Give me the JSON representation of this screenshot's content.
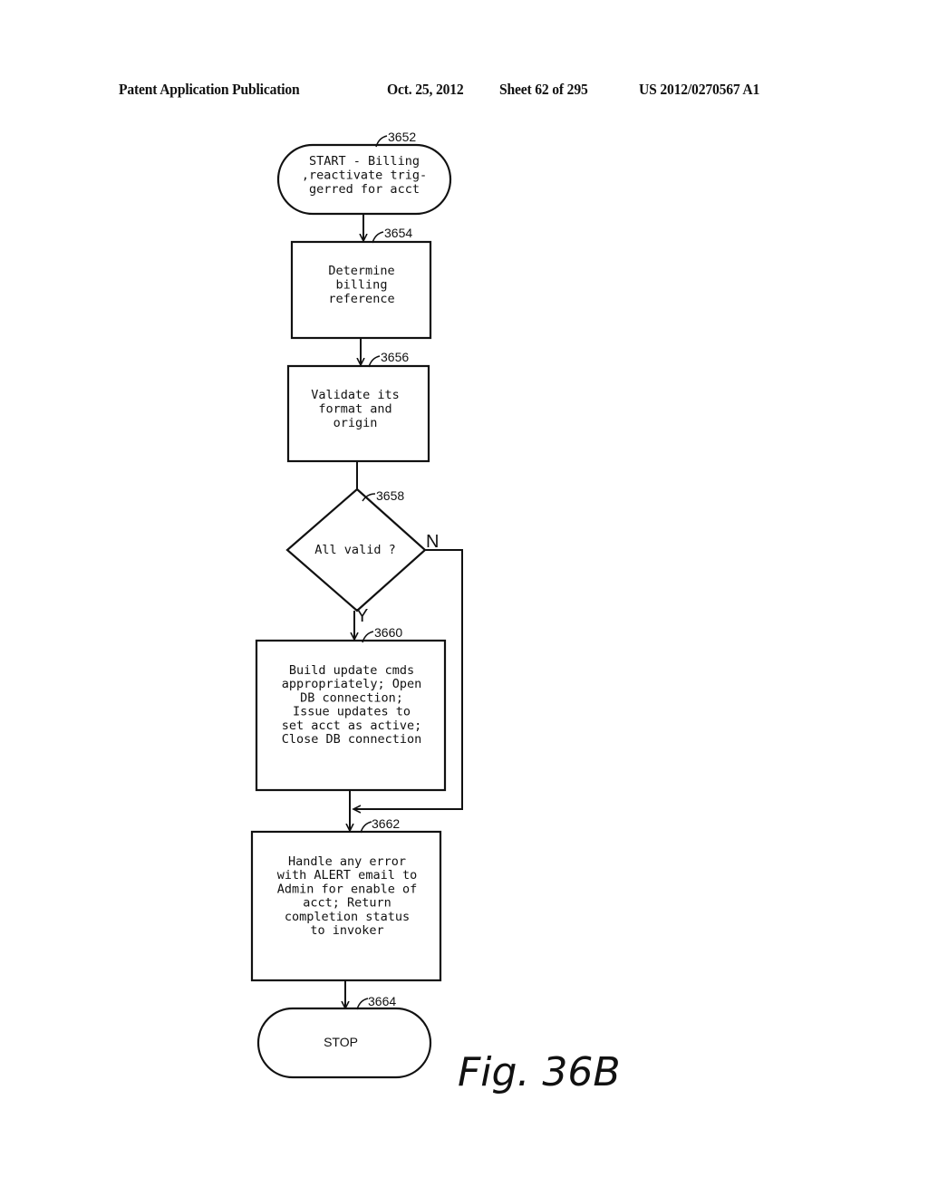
{
  "header": {
    "publication": "Patent Application Publication",
    "date": "Oct. 25, 2012",
    "sheet": "Sheet 62 of 295",
    "number": "US 2012/0270567 A1"
  },
  "flowchart": {
    "nodes": [
      {
        "id": "3652",
        "type": "terminal",
        "lines": [
          "START - Billing",
          ",reactivate trig-",
          "gerred for acct"
        ]
      },
      {
        "id": "3654",
        "type": "process",
        "lines": [
          "Determine",
          "billing",
          "reference"
        ]
      },
      {
        "id": "3656",
        "type": "process",
        "lines": [
          "Validate its",
          "format and",
          "origin"
        ]
      },
      {
        "id": "3658",
        "type": "decision",
        "lines": [
          "All valid ?"
        ]
      },
      {
        "id": "3660",
        "type": "process",
        "lines": [
          "Build update cmds",
          "appropriately; Open",
          "DB connection;",
          "Issue updates to",
          "set acct as active;",
          "Close DB connection"
        ]
      },
      {
        "id": "3662",
        "type": "process",
        "lines": [
          "Handle any error",
          "with ALERT email to",
          "Admin for enable of",
          "acct; Return",
          "completion status",
          "to invoker"
        ]
      },
      {
        "id": "3664",
        "type": "terminal",
        "lines": [
          "STOP"
        ]
      }
    ],
    "branch_labels": {
      "no": "N",
      "yes": "Y"
    },
    "figure_label": "Fig. 36B"
  }
}
